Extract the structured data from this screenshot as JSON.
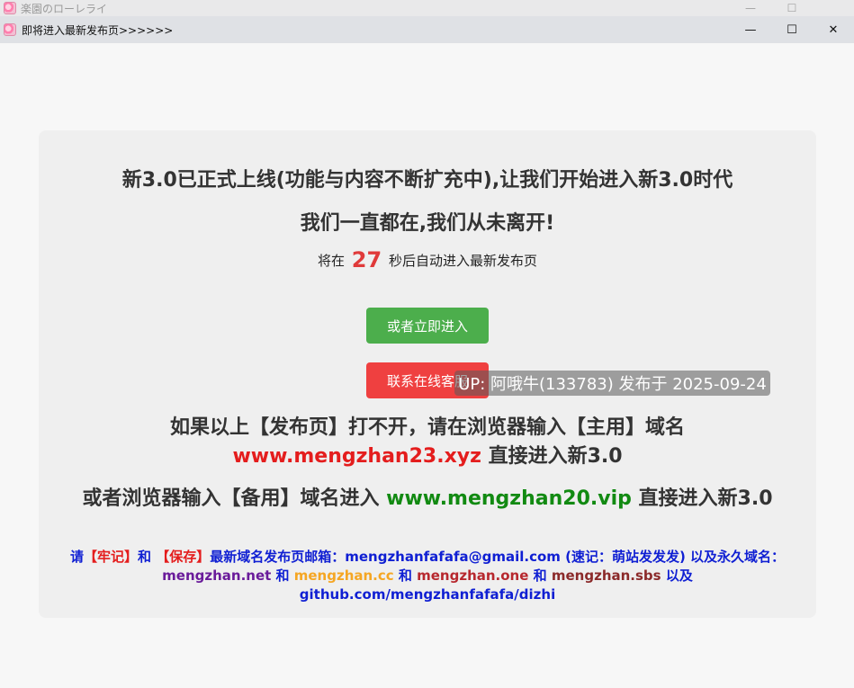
{
  "window": {
    "outer_title": "楽園のローレライ",
    "inner_title": "即将进入最新发布页>>>>>>"
  },
  "content": {
    "headline1": "新3.0已正式上线(功能与内容不断扩充中),让我们开始进入新3.0时代",
    "headline2": "我们一直都在,我们从未离开!",
    "countdown_prefix": "将在",
    "countdown_value": "27",
    "countdown_suffix": "秒后自动进入最新发布页",
    "enter_button": "或者立即进入",
    "support_button": "联系在线客服",
    "up_badge": "UP: 阿哦牛(133783) 发布于 2025-09-24",
    "primary_text1": "如果以上【发布页】打不开，请在浏览器输入【主用】域名",
    "primary_domain": "www.mengzhan23.xyz",
    "primary_text2": " 直接进入新3.0",
    "backup_text1": "或者浏览器输入【备用】域名进入 ",
    "backup_domain": "www.mengzhan20.vip",
    "backup_text2": " 直接进入新3.0",
    "footer": {
      "p1": "请",
      "remember": "【牢记】",
      "p2": "和 ",
      "save": "【保存】",
      "p3": "最新域名发布页邮箱：mengzhanfafafa@gmail.com (速记：萌站发发发) 以及永久域名：",
      "d1": "mengzhan.net",
      "and1": " 和 ",
      "d2": "mengzhan.cc",
      "and2": " 和 ",
      "d3": "mengzhan.one",
      "and3": " 和 ",
      "d4": "mengzhan.sbs",
      "p4": " 以及 github.com/mengzhanfafafa/dizhi"
    }
  },
  "colors": {
    "accent_green": "#4cae4c",
    "accent_red": "#ef4040",
    "link_blue": "#0f1fd3"
  }
}
